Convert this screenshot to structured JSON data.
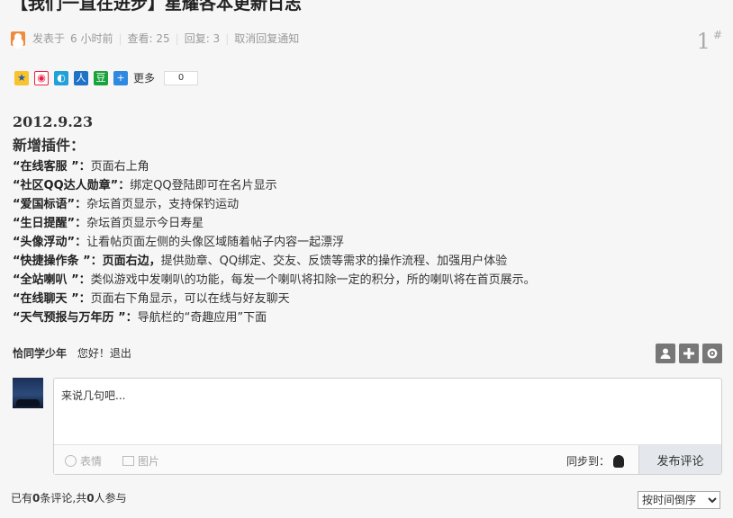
{
  "post": {
    "title": "【我们一直在进步】星耀各本更新日志",
    "meta": {
      "posted_prefix": "发表于",
      "posted_time": "6 小时前",
      "views_label": "查看: 25",
      "replies_label": "回复: 3",
      "notify_link": "取消回复通知"
    },
    "floor": {
      "number": "1",
      "sign": "#"
    }
  },
  "share": {
    "icons": [
      "qzone-icon",
      "weibo-icon",
      "tencent-weibo-icon",
      "renren-icon",
      "douban-icon",
      "more-icon"
    ],
    "more_label": "更多",
    "count": "0"
  },
  "content": {
    "date": "2012.9.23",
    "heading": "新增插件：",
    "items": [
      {
        "label": "“在线客服 ”：",
        "text": "页面右上角"
      },
      {
        "label": "“社区QQ达人勋章”：",
        "text": "绑定QQ登陆即可在名片显示"
      },
      {
        "label": "“爱国标语”：",
        "text": "杂坛首页显示，支持保钓运动"
      },
      {
        "label": "“生日提醒”：",
        "text": "杂坛首页显示今日寿星"
      },
      {
        "label": "“头像浮动”：",
        "text": "让看帖页面左侧的头像区域随着帖子内容一起漂浮"
      },
      {
        "label": "“快捷操作条 ”：页面右边，",
        "text": "提供勋章、QQ绑定、交友、反馈等需求的操作流程、加强用户体验"
      },
      {
        "label": "“全站喇叭 ”：",
        "text": "类似游戏中发喇叭的功能，每发一个喇叭将扣除一定的积分，所的喇叭将在首页展示。"
      },
      {
        "label": "“在线聊天 ”：",
        "text": "页面右下角显示，可以在线与好友聊天"
      },
      {
        "label": "“天气预报与万年历 ”：",
        "text": "导航栏的“奇趣应用”下面"
      }
    ]
  },
  "user": {
    "name": "恰同学少年",
    "greeting": "您好！",
    "logout": "退出"
  },
  "toolbar": {
    "icons": [
      "user-icon",
      "plus-icon",
      "gear-icon"
    ]
  },
  "comment": {
    "placeholder": "来说几句吧...",
    "emoji_label": "表情",
    "image_label": "图片",
    "sync_label": "同步到：",
    "submit_label": "发布评论"
  },
  "footer": {
    "stats_prefix": "已有",
    "comment_count": "0",
    "stats_middle": "条评论,共",
    "participant_count": "0",
    "stats_suffix": "人参与",
    "sort_selected": "按时间倒序"
  }
}
